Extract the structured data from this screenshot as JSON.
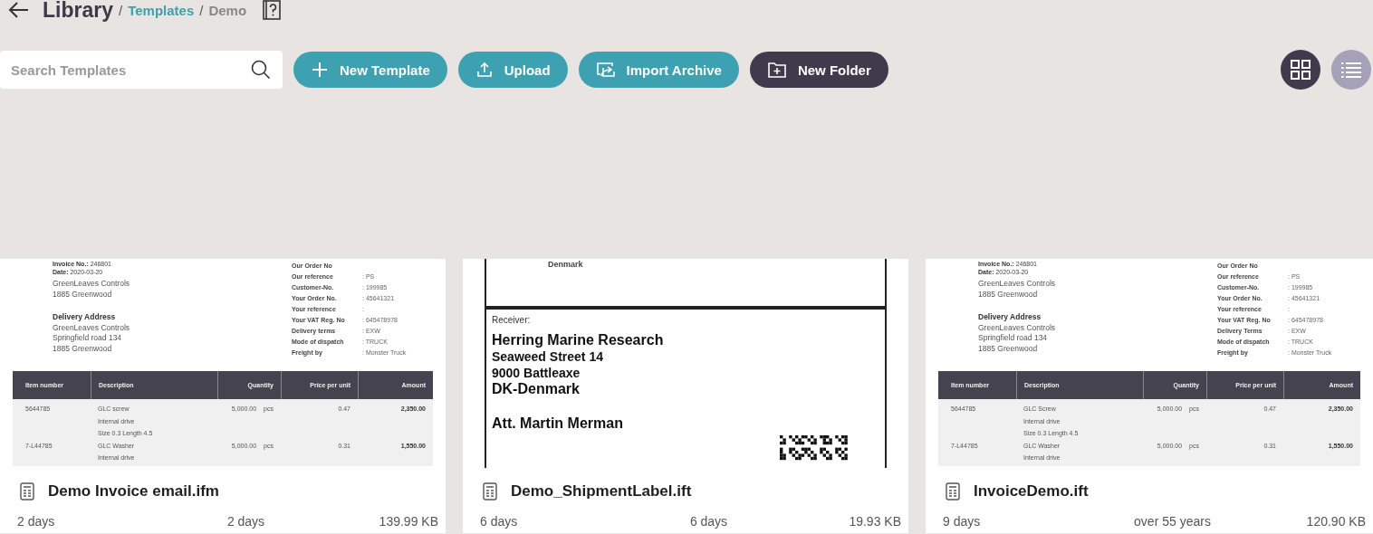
{
  "header": {
    "title": "Library",
    "breadcrumbs": [
      {
        "separator": "/",
        "label": "Templates",
        "link": true
      },
      {
        "separator": "/",
        "label": "Demo",
        "link": false
      }
    ]
  },
  "toolbar": {
    "search": {
      "placeholder": "Search Templates"
    },
    "buttons": [
      {
        "label": "New Template",
        "kind": "add"
      },
      {
        "label": "Upload",
        "kind": "upload"
      },
      {
        "label": "Import Archive",
        "kind": "import"
      },
      {
        "label": "New Folder",
        "kind": "folder"
      }
    ],
    "views": [
      {
        "kind": "grid",
        "selected": true
      },
      {
        "kind": "list",
        "selected": false
      }
    ]
  },
  "cards": [
    {
      "name": "Demo Invoice email.ifm",
      "time_1": "2 days",
      "time_2": "2 days",
      "size": "139.99 KB",
      "preview": {
        "kind": "invoice",
        "header_lines": [
          "**Invoice No.:** 246801",
          "**Date:** 2020-03-20"
        ],
        "address": [
          "GreenLeaves Controls",
          "1885 Greenwood"
        ],
        "delivery_title": "Delivery Address",
        "delivery": [
          "GreenLeaves Controls",
          "Springfield road 134",
          "1885 Greenwood"
        ],
        "fields": [
          {
            "label": "Our Order No"
          },
          {
            "label": "Our reference",
            "value": ": PS"
          },
          {
            "label": "Customer-No.",
            "value": ": 199985"
          },
          {
            "label": "Your Order No.",
            "value": ": 45641321"
          },
          {
            "label": "Your reference",
            "value": ":"
          },
          {
            "label": "Your VAT Reg. No",
            "value": ": 645478978"
          },
          {
            "label": "Delivery terms",
            "value": ": EXW"
          },
          {
            "label": "Mode of dispatch",
            "value": ": TRUCK"
          },
          {
            "label": "Freight by",
            "value": ": Monster Truck"
          }
        ],
        "columns": [
          "Item number",
          "Description",
          "Quantity",
          "Price per unit",
          "Amount"
        ],
        "rows": [
          {
            "item": "5644785",
            "description": [
              "GLC screw",
              "Internal drive",
              "Size 0.3    Length 4.5"
            ],
            "quantity": "5,000.00",
            "unit": "pcs",
            "price": "0.47",
            "amount": "2,350.00"
          },
          {
            "item": "7-L44785",
            "description": [
              "GLC Washer",
              "Internal drive"
            ],
            "quantity": "5,000.00",
            "unit": "pcs",
            "price": "0.31",
            "amount": "1,550.00"
          }
        ]
      }
    },
    {
      "name": "Demo_ShipmentLabel.ift",
      "time_1": "6 days",
      "time_2": "6 days",
      "size": "19.93 KB",
      "preview": {
        "kind": "label",
        "sender_tail": "Denmark",
        "receiver_title": "Receiver:",
        "name": "Herring Marine Research",
        "street": "Seaweed Street 14",
        "city": "9000 Battleaxe",
        "country": "DK-Denmark",
        "attention": "Att. Martin Merman"
      }
    },
    {
      "name": "InvoiceDemo.ift",
      "time_1": "9 days",
      "time_2": "over 55 years",
      "size": "120.90 KB",
      "preview": {
        "kind": "invoice",
        "header_lines": [
          "**Invoice No.:** 246801",
          "**Date:** 2020-03-20"
        ],
        "address": [
          "GreenLeaves Controls",
          "1885 Greenwood"
        ],
        "delivery_title": "Delivery Address",
        "delivery": [
          "GreenLeaves Controls",
          "Springfield road 134",
          "1885 Greenwood"
        ],
        "fields": [
          {
            "label": "Our Order No"
          },
          {
            "label": "Our reference",
            "value": ": PS"
          },
          {
            "label": "Customer-No.",
            "value": ": 199985"
          },
          {
            "label": "Your Order No.",
            "value": ": 45641321"
          },
          {
            "label": "Your reference",
            "value": ":"
          },
          {
            "label": "Your VAT Reg. No",
            "value": ": 645478978"
          },
          {
            "label": "Delivery Terms",
            "value": ": EXW"
          },
          {
            "label": "Mode of dispatch",
            "value": ": TRUCK"
          },
          {
            "label": "Freight by",
            "value": ": Monster Truck"
          }
        ],
        "columns": [
          "Item number",
          "Description",
          "Quantity",
          "Price per unit",
          "Amount"
        ],
        "rows": [
          {
            "item": "5644785",
            "description": [
              "GLC Screw",
              "Internal drive",
              "Size 0.3    Length 4.5"
            ],
            "quantity": "5,000.00",
            "unit": "pcs",
            "price": "0.47",
            "amount": "2,350.00"
          },
          {
            "item": "7-L44785",
            "description": [
              "GLC Washer",
              "Internal drive"
            ],
            "quantity": "5,000.00",
            "unit": "pcs",
            "price": "0.31",
            "amount": "1,550.00"
          }
        ]
      }
    }
  ]
}
